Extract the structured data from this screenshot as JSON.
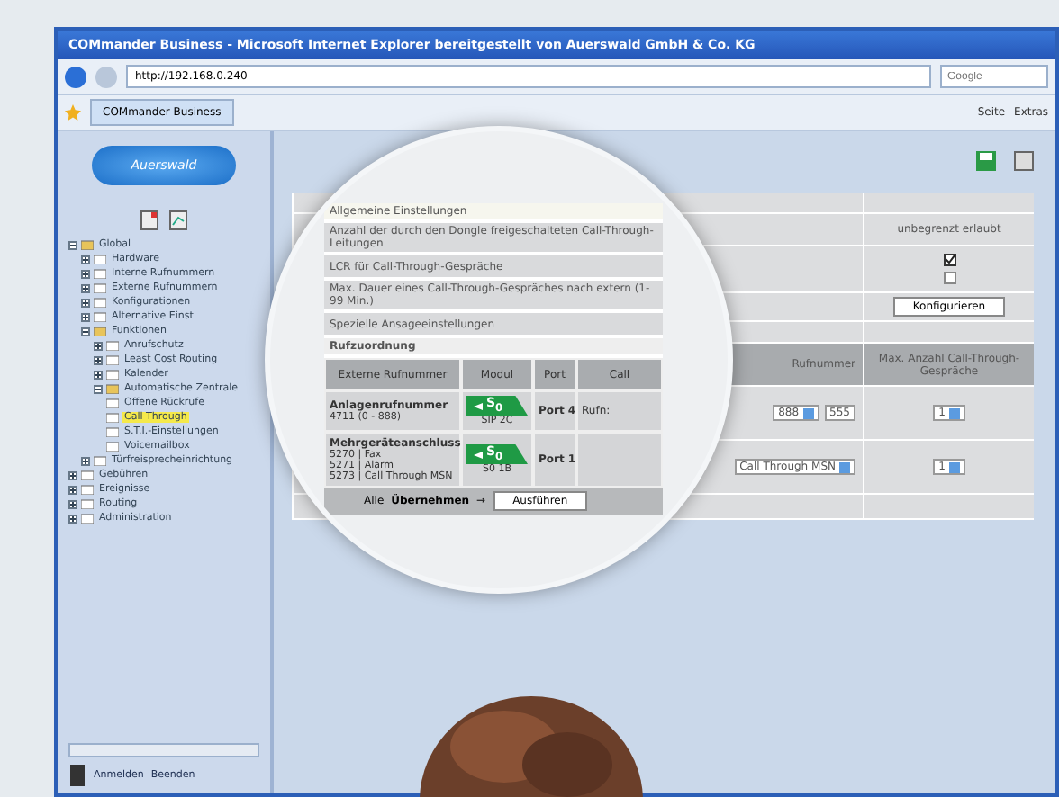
{
  "window": {
    "title": "COMmander Business - Microsoft Internet Explorer bereitgestellt von Auerswald GmbH & Co. KG"
  },
  "browser": {
    "address": "http://192.168.0.240",
    "search_placeholder": "Google",
    "tab": "COMmander Business",
    "commands": [
      "Seite",
      "Extras"
    ]
  },
  "sidebar": {
    "logo": "Auerswald",
    "tree": [
      {
        "label": "Global",
        "expanded": true,
        "selected": false,
        "children": [
          {
            "label": "Hardware",
            "expanded": false,
            "selected": false
          },
          {
            "label": "Interne Rufnummern",
            "expanded": false,
            "selected": false
          },
          {
            "label": "Externe Rufnummern",
            "expanded": false,
            "selected": false
          },
          {
            "label": "Konfigurationen",
            "expanded": false,
            "selected": false
          },
          {
            "label": "Alternative Einst.",
            "expanded": false,
            "selected": false
          },
          {
            "label": "Funktionen",
            "expanded": true,
            "selected": false,
            "children": [
              {
                "label": "Anrufschutz",
                "expanded": false,
                "selected": false
              },
              {
                "label": "Least Cost Routing",
                "expanded": false,
                "selected": false
              },
              {
                "label": "Kalender",
                "expanded": false,
                "selected": false
              },
              {
                "label": "Automatische Zentrale",
                "expanded": true,
                "selected": false,
                "children": [
                  {
                    "label": "Offene Rückrufe",
                    "selected": false
                  },
                  {
                    "label": "Call Through",
                    "selected": true
                  },
                  {
                    "label": "S.T.I.-Einstellungen",
                    "selected": false
                  },
                  {
                    "label": "Voicemailbox",
                    "selected": false
                  }
                ]
              }
            ]
          },
          {
            "label": "Türfreisprecheinrichtung",
            "expanded": false,
            "selected": false
          }
        ]
      },
      {
        "label": "Gebühren",
        "expanded": false,
        "selected": false
      },
      {
        "label": "Ereignisse",
        "expanded": false,
        "selected": false
      },
      {
        "label": "Routing",
        "expanded": false,
        "selected": false
      },
      {
        "label": "Administration",
        "expanded": false,
        "selected": false
      }
    ],
    "footer": [
      "Anmelden",
      "Beenden"
    ]
  },
  "settings_right": {
    "unlimited": "unbegrenzt erlaubt",
    "lcr_checked": true,
    "announce_checked": false,
    "configure_button": "Konfigurieren"
  },
  "table_right": {
    "column_4": "Rufnummer",
    "column_5": "Max. Anzahl Call-Through-Gespräche",
    "rows": [
      {
        "rufn": "888",
        "length": "555",
        "select": "1"
      },
      {
        "rufn": "Call Through MSN",
        "select": "1"
      }
    ]
  },
  "magnifier": {
    "section": "Allgemeine Einstellungen",
    "settings": [
      "Anzahl der durch den Dongle freigeschalteten Call-Through-Leitungen",
      "LCR für Call-Through-Gespräche",
      "Max. Dauer eines Call-Through-Gespräches nach extern (1-99 Min.)",
      "Spezielle Ansageeinstellungen"
    ],
    "table_title": "Rufzuordnung",
    "columns": [
      "Externe Rufnummer",
      "Modul",
      "Port",
      "Call"
    ],
    "rows": [
      {
        "name": "Anlagenrufnummer",
        "numbers": [
          "4711 (0 - 888)"
        ],
        "module": "S$_{0}$",
        "module_label": "SIP 2C",
        "port": "Port 4",
        "rufn": "Rufn:"
      },
      {
        "name": "Mehrgeräteanschluss",
        "numbers": [
          "5270 | Fax",
          "5271 | Alarm",
          "5273 | Call Through MSN"
        ],
        "module": "S$_{0}$",
        "module_label": "S0 1B",
        "port": "Port 1"
      }
    ],
    "footer": {
      "all": "Alle",
      "apply": "Übernehmen",
      "arrow": "→",
      "execute": "Ausführen"
    }
  }
}
